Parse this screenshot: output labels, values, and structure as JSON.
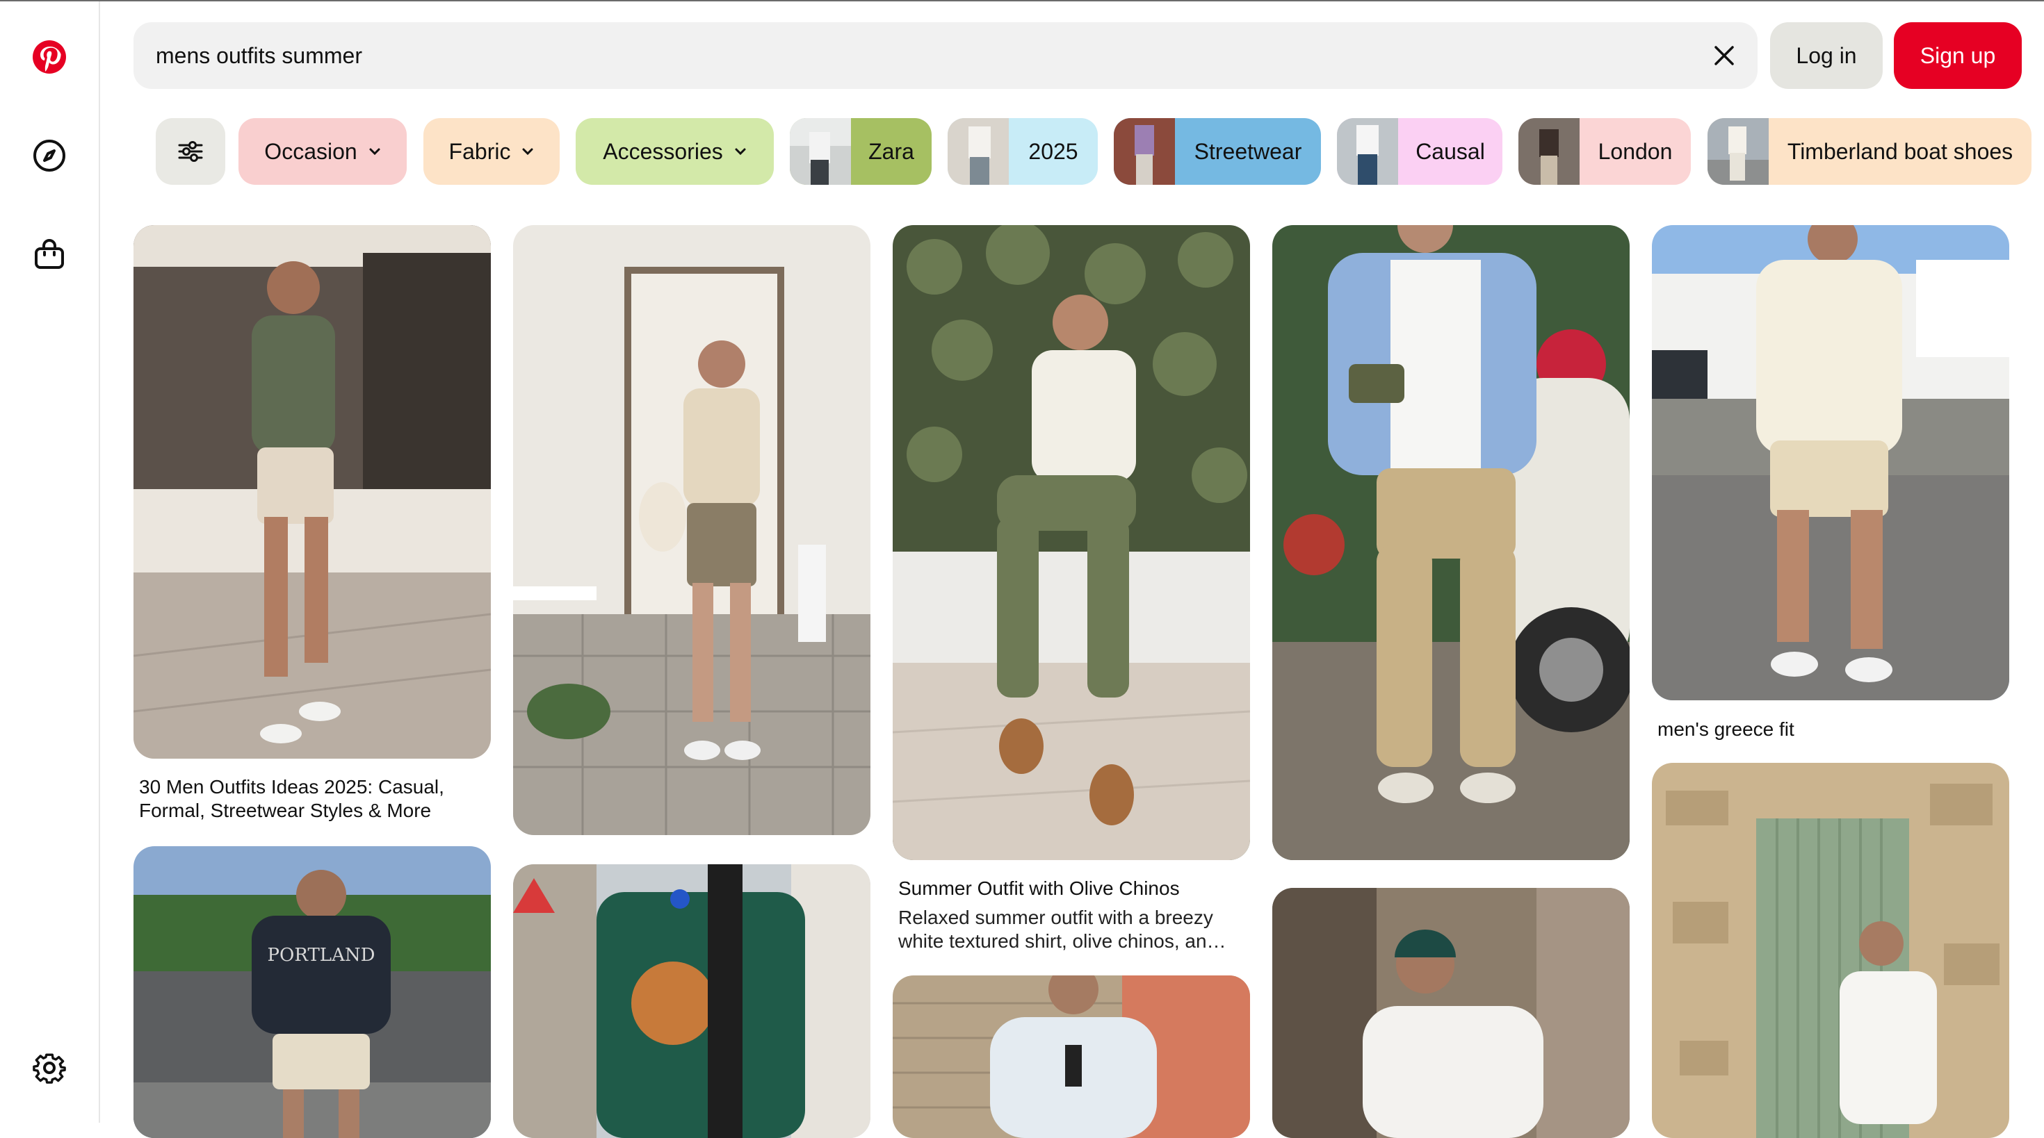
{
  "search": {
    "query": "mens outfits summer"
  },
  "header": {
    "login_label": "Log in",
    "signup_label": "Sign up"
  },
  "sidebar": {
    "icons": [
      "pinterest-logo",
      "compass-icon",
      "shopping-bag-icon",
      "gear-icon"
    ]
  },
  "filters": {
    "icon": "sliders-icon",
    "dropdowns": [
      {
        "label": "Occasion",
        "color": "#f9cfcf"
      },
      {
        "label": "Fabric",
        "color": "#fde3c7"
      },
      {
        "label": "Accessories",
        "color": "#d3e9a9"
      }
    ],
    "suggestions": [
      {
        "label": "Zara",
        "color": "#a6c062"
      },
      {
        "label": "2025",
        "color": "#c8ecf7"
      },
      {
        "label": "Streetwear",
        "color": "#75b9e2"
      },
      {
        "label": "Causal",
        "color": "#fbd0f3"
      },
      {
        "label": "London",
        "color": "#fbd5d5"
      },
      {
        "label": "Timberland boat shoes",
        "color": "#fde3c7"
      }
    ]
  },
  "pins": {
    "col1_top": {
      "title": "30 Men Outfits Ideas 2025: Casual, Formal, Streetwear Styles & More"
    },
    "col3_top": {
      "title": "Summer Outfit with Olive Chinos",
      "description": "Relaxed summer outfit with a breezy white textured shirt, olive chinos, an…"
    },
    "col5_top": {
      "title": "men's greece fit"
    },
    "col1_bottom_print": "PORTLAND"
  },
  "colors": {
    "brand": "#e60023"
  }
}
